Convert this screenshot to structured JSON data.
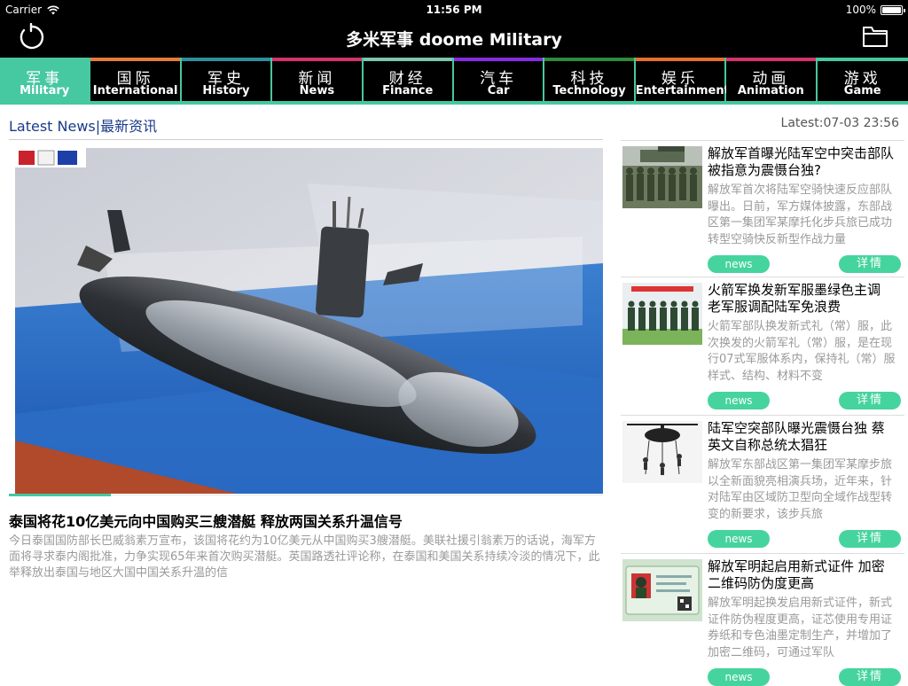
{
  "status_bar": {
    "carrier": "Carrier",
    "time": "11:56 PM",
    "battery": "100%",
    "battery_level": 1.0
  },
  "nav": {
    "title": "多米军事 doome Military",
    "refresh_icon": "refresh-icon",
    "folder_icon": "folder-icon"
  },
  "tabs": [
    {
      "zh": "军事",
      "en": "Military",
      "color": "#46c8a0",
      "active": true
    },
    {
      "zh": "国际",
      "en": "International",
      "color": "#e87a3c"
    },
    {
      "zh": "军史",
      "en": "History",
      "color": "#2f8fa0"
    },
    {
      "zh": "新闻",
      "en": "News",
      "color": "#d6326e"
    },
    {
      "zh": "财经",
      "en": "Finance",
      "color": "#7cc7b0"
    },
    {
      "zh": "汽车",
      "en": "Car",
      "color": "#8a2be2"
    },
    {
      "zh": "科技",
      "en": "Technology",
      "color": "#2e8b3a"
    },
    {
      "zh": "娱乐",
      "en": "Entertainment",
      "color": "#e8702a"
    },
    {
      "zh": "动画",
      "en": "Animation",
      "color": "#d6326e"
    },
    {
      "zh": "游戏",
      "en": "Game",
      "color": "#46c8a0"
    }
  ],
  "section": {
    "label_en": "Latest News",
    "label_zh": "最新资讯",
    "updated": "Latest:07-03 23:56"
  },
  "featured": {
    "title": "泰国将花10亿美元向中国购买三艘潜艇 释放两国关系升温信号",
    "summary": "今日泰国国防部长巴威翁素万宣布，该国将花约为10亿美元从中国购买3艘潜艇。美联社援引翁素万的话说，海军方面将寻求泰内阁批准，力争实现65年来首次购买潜艇。英国路透社评论称，在泰国和美国关系持续冷淡的情况下，此举释放出泰国与地区大国中国关系升温的信"
  },
  "news": [
    {
      "title": "解放军首曝光陆军空中突击部队 被指意为震慑台独?",
      "summary": "解放军首次将陆军空骑快速反应部队曝出。日前，军方媒体披露，东部战区第一集团军某摩托化步兵旅已成功转型空骑快反新型作战力量",
      "tag": "news",
      "more": "详情"
    },
    {
      "title": "火箭军换发新军服墨绿色主调 老军服调配陆军免浪费",
      "summary": "火箭军部队换发新式礼（常）服，此次换发的火箭军礼（常）服，是在现行07式军服体系内，保持礼（常）服样式、结构、材料不变",
      "tag": "news",
      "more": "详情"
    },
    {
      "title": "陆军空突部队曝光震慑台独 蔡英文自称总统太猖狂",
      "summary": "解放军东部战区第一集团军某摩步旅以全新面貌亮相演兵场，近年来，针对陆军由区域防卫型向全域作战型转变的新要求，该步兵旅",
      "tag": "news",
      "more": "详情"
    },
    {
      "title": "解放军明起启用新式证件 加密二维码防伪度更高",
      "summary": "解放军明起换发启用新式证件，新式证件防伪程度更高，证芯使用专用证券纸和专色油墨定制生产，并增加了加密二维码，可通过军队",
      "tag": "news",
      "more": "详情"
    }
  ]
}
